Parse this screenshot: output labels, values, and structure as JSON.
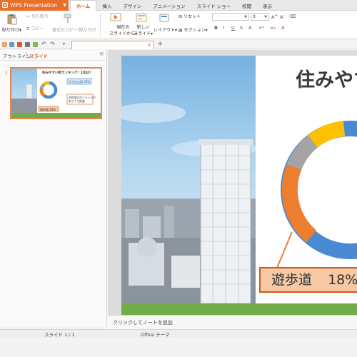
{
  "app": {
    "title": "WPS Presentation"
  },
  "ribbon_tabs": [
    "ホーム",
    "挿入",
    "デザイン",
    "アニメーション",
    "スライド ショー",
    "校閲",
    "表示"
  ],
  "ribbon": {
    "paste": "貼り付け",
    "cut": "切り取り",
    "copy": "コピー",
    "format_painter": "書式のコピー/貼り付け",
    "from_current_line1": "現在の",
    "from_current_line2": "スライドから",
    "new_slide_line1": "新しい",
    "new_slide_line2": "スライド",
    "layout": "レイアウト",
    "reset": "リセット",
    "section": "セクション",
    "font_size_value": "0",
    "format_buttons": [
      "B",
      "I",
      "U",
      "S",
      "A",
      "×²",
      "×₂",
      "A"
    ]
  },
  "left_panel": {
    "tab_outline": "アウトライン",
    "tab_slides": "スライド",
    "slide_number": "1"
  },
  "slide": {
    "title": "住みやすい街ランキング！1位は？",
    "callout_label": "遊歩道",
    "callout_value": "18%",
    "donut_segments": [
      {
        "name": "blue",
        "value": 50,
        "color": "#4a8ad4"
      },
      {
        "name": "orange",
        "value": 18,
        "color": "#ee7e2f"
      },
      {
        "name": "gray",
        "value": 10,
        "color": "#a4a4a4"
      },
      {
        "name": "yellow",
        "value": 12,
        "color": "#ffc000"
      },
      {
        "name": "blue2",
        "value": 10,
        "color": "#4a8ad4"
      }
    ]
  },
  "thumbnail": {
    "title": "住みやすい街ランキング！1位は？",
    "blue_label": "大きな公園",
    "blue_value": "38%",
    "box_text_line1": "市民協力のイメージの",
    "box_text_line2": "街づくり推進",
    "callout_label": "遊歩道",
    "callout_value": "18%"
  },
  "notes": {
    "placeholder": "クリックしてノートを追加"
  },
  "status": {
    "slide_counter": "スライド 1 / 1",
    "theme": "Office テーマ"
  },
  "colors": {
    "accent": "#e8702a",
    "grass": "#70ad47",
    "callout_fill": "#f7c8a4"
  }
}
